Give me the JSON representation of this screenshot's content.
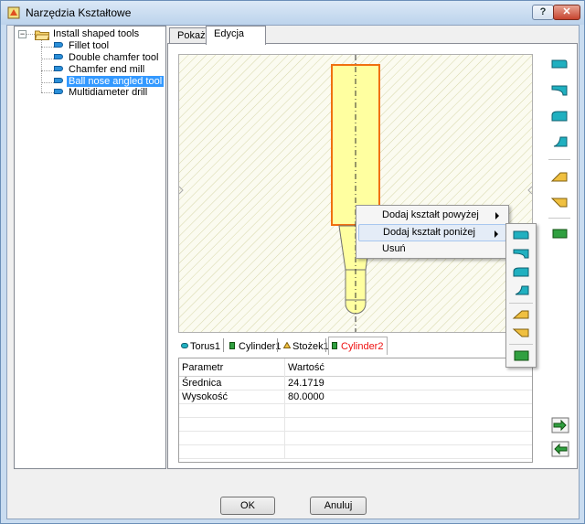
{
  "window": {
    "title": "Narzędzia Kształtowe",
    "help_label": "?",
    "close_label": "✕"
  },
  "tree": {
    "expander": "−",
    "root": "Install shaped tools",
    "items": [
      {
        "label": "Fillet tool",
        "selected": false
      },
      {
        "label": "Double chamfer tool",
        "selected": false
      },
      {
        "label": "Chamfer end mill",
        "selected": false
      },
      {
        "label": "Ball nose angled tool",
        "selected": true
      },
      {
        "label": "Multidiameter drill",
        "selected": false
      }
    ]
  },
  "tabs": [
    {
      "label": "Pokaż"
    },
    {
      "label": "Edycja"
    }
  ],
  "shape_tabs": [
    {
      "label": "Torus1",
      "icon": "torus-icon"
    },
    {
      "label": "Cylinder1",
      "icon": "cylinder-icon"
    },
    {
      "label": "Stożek1",
      "icon": "cone-icon"
    },
    {
      "label": "Cylinder2",
      "icon": "cylinder-icon"
    }
  ],
  "params": {
    "headers": [
      "Parametr",
      "Wartość"
    ],
    "rows": [
      [
        "Średnica",
        "24.1719"
      ],
      [
        "Wysokość",
        "80.0000"
      ]
    ]
  },
  "context_menu": {
    "items": [
      {
        "label": "Dodaj kształt powyżej",
        "submenu": true
      },
      {
        "label": "Dodaj kształt poniżej",
        "submenu": true
      },
      {
        "label": "Usuń",
        "submenu": false
      }
    ]
  },
  "buttons": {
    "ok": "OK",
    "cancel": "Anuluj"
  },
  "colors": {
    "accent": "#3399ff",
    "active_tab": "#ee1111",
    "shape_outline": "#f07010",
    "shape_fill": "#ffffa0",
    "teal_icon": "#20b0c0",
    "gold_icon": "#f0c040",
    "green_icon": "#30a040"
  }
}
